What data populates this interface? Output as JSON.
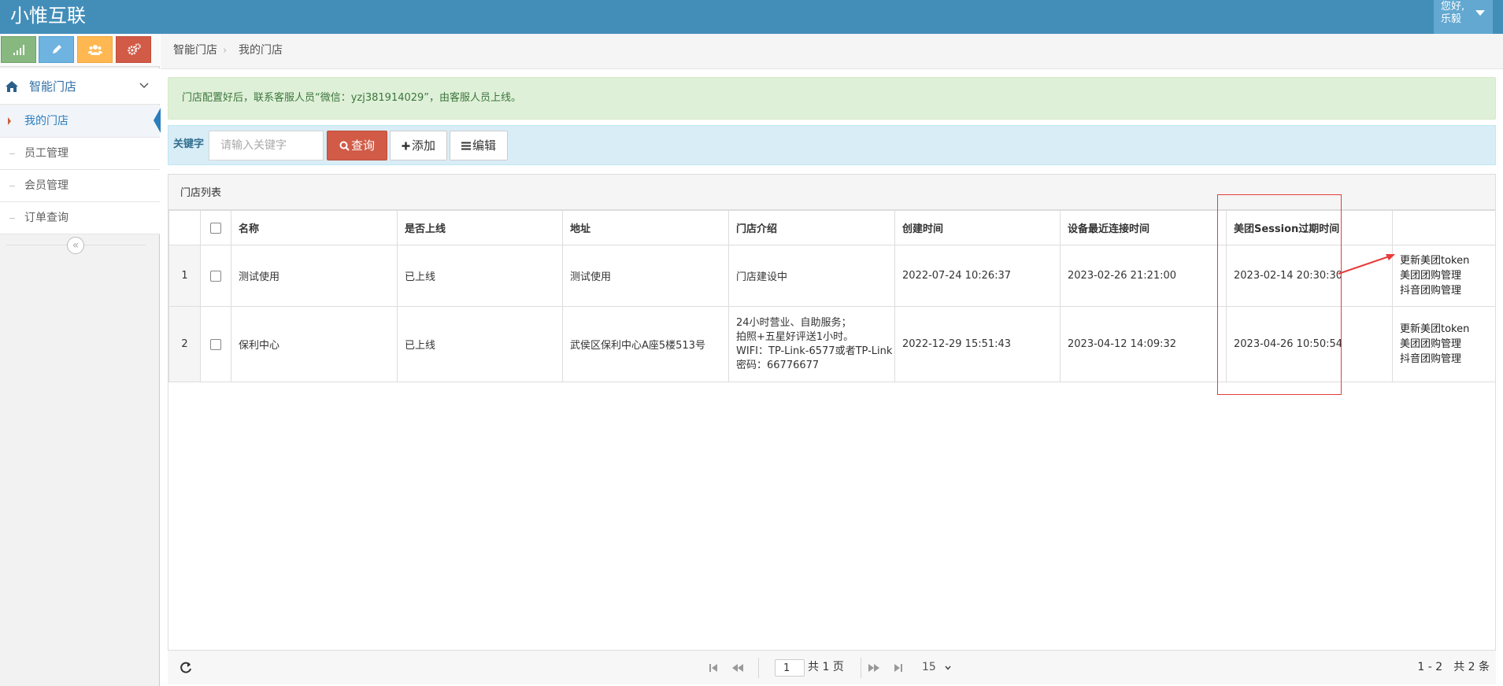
{
  "header": {
    "brand": "小惟互联",
    "user_greeting": "您好,乐毅"
  },
  "sidebar": {
    "shortcuts": [
      {
        "icon": "signal-icon",
        "color": "#87b87f"
      },
      {
        "icon": "pencil-icon",
        "color": "#6fb3e0"
      },
      {
        "icon": "users-icon",
        "color": "#ffb752"
      },
      {
        "icon": "cogs-icon",
        "color": "#d15b47"
      }
    ],
    "parent": {
      "label": "智能门店",
      "icon": "home-icon"
    },
    "items": [
      {
        "label": "我的门店",
        "active": true
      },
      {
        "label": "员工管理",
        "active": false
      },
      {
        "label": "会员管理",
        "active": false
      },
      {
        "label": "订单查询",
        "active": false
      }
    ],
    "collapse_glyph": "«"
  },
  "breadcrumb": {
    "parent": "智能门店",
    "separator": "›",
    "current": "我的门店"
  },
  "alert": {
    "text": "门店配置好后，联系客服人员“微信：yzj381914029”，由客服人员上线。"
  },
  "search": {
    "label": "关键字",
    "placeholder": "请输入关键字",
    "search_button": "查询",
    "add_button": "添加",
    "edit_button": "编辑"
  },
  "panel": {
    "title": "门店列表"
  },
  "table": {
    "columns": [
      "名称",
      "是否上线",
      "地址",
      "门店介绍",
      "创建时间",
      "设备最近连接时间",
      "美团Session过期时间",
      ""
    ],
    "rows": [
      {
        "num": "1",
        "name": "测试使用",
        "online": "已上线",
        "address": "测试使用",
        "intro": [
          "门店建设中"
        ],
        "created": "2022-07-24 10:26:37",
        "last_connect": "2023-02-26 21:21:00",
        "session_expire": "2023-02-14 20:30:30",
        "ops": [
          "更新美团token",
          "美团团购管理",
          "抖音团购管理"
        ]
      },
      {
        "num": "2",
        "name": "保利中心",
        "online": "已上线",
        "address": "武侯区保利中心A座5楼513号",
        "intro": [
          "24小时营业、自助服务；",
          "拍照+五星好评送1小时。",
          "WIFI：TP-Link-6577或者TP-Link",
          "密码：66776677"
        ],
        "created": "2022-12-29 15:51:43",
        "last_connect": "2023-04-12 14:09:32",
        "session_expire": "2023-04-26 10:50:54",
        "ops": [
          "更新美团token",
          "美团团购管理",
          "抖音团购管理"
        ]
      }
    ]
  },
  "pager": {
    "page": "1",
    "total_pages": "共 1 页",
    "page_size": "15",
    "range": "1 - 2　共 2 条"
  },
  "annotation_color": "#e83c3c"
}
